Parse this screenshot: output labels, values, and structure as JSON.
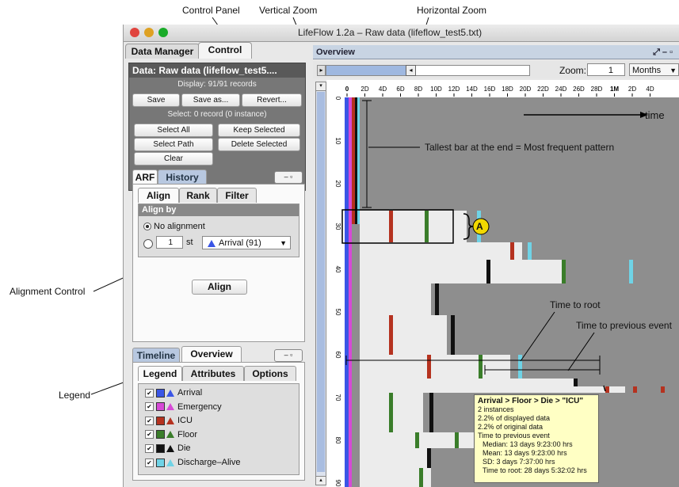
{
  "callouts": {
    "control_panel": "Control Panel",
    "vertical_zoom": "Vertical Zoom",
    "horizontal_zoom": "Horizontal Zoom",
    "alignment_control": "Alignment Control",
    "legend": "Legend",
    "time": "time",
    "tallest_bar": "Tallest bar at the end = Most frequent pattern",
    "marker_a": "A",
    "time_to_root": "Time to root",
    "time_to_previous": "Time to previous event"
  },
  "window": {
    "title": "LifeFlow 1.2a – Raw data (lifeflow_test5.txt)"
  },
  "left_tabs": [
    "Data Manager",
    "Control"
  ],
  "data_box": {
    "header": "Data: Raw data (lifeflow_test5....",
    "display": "Display: 91/91 records",
    "save": "Save",
    "save_as": "Save as...",
    "revert": "Revert...",
    "select": "Select: 0 record (0 instance)",
    "select_all": "Select All",
    "keep_selected": "Keep Selected",
    "select_path": "Select Path",
    "delete_selected": "Delete Selected",
    "clear": "Clear"
  },
  "arf_tabs": [
    "ARF",
    "History"
  ],
  "align_tabs": [
    "Align",
    "Rank",
    "Filter"
  ],
  "align_by": {
    "header": "Align by",
    "no_alignment": "No alignment",
    "stepper_value": "1",
    "ordinal_suffix": "st",
    "event_option": "Arrival (91)",
    "align_button": "Align"
  },
  "bottom_tabs": [
    "Timeline",
    "Overview"
  ],
  "legend_tabs": [
    "Legend",
    "Attributes",
    "Options"
  ],
  "legend_items": [
    {
      "label": "Arrival",
      "color": "#3a55e6"
    },
    {
      "label": "Emergency",
      "color": "#d64ad6"
    },
    {
      "label": "ICU",
      "color": "#b5321f"
    },
    {
      "label": "Floor",
      "color": "#3a7d2a"
    },
    {
      "label": "Die",
      "color": "#111111"
    },
    {
      "label": "Discharge–Alive",
      "color": "#6fd3e6"
    }
  ],
  "overview": {
    "title": "Overview",
    "zoom_label": "Zoom:",
    "zoom_value": "1",
    "zoom_unit": "Months",
    "x_ticks": [
      "0",
      "2D",
      "4D",
      "6D",
      "8D",
      "10D",
      "12D",
      "14D",
      "16D",
      "18D",
      "20D",
      "22D",
      "24D",
      "26D",
      "28D",
      "1M",
      "2D",
      "4D"
    ],
    "y_ticks": [
      "0",
      "10",
      "20",
      "30",
      "40",
      "50",
      "60",
      "70",
      "80",
      "90"
    ]
  },
  "tooltip": {
    "title": "Arrival > Floor > Die > \"ICU\"",
    "lines": [
      "2 instances",
      "2.2% of displayed data",
      "2.2% of original data",
      "Time to previous event",
      "Median: 13 days 9:23:00 hrs",
      "Mean: 13 days 9:23:00 hrs",
      "SD: 3 days 7:37:00 hrs",
      "Time to root: 28 days 5:32:02 hrs"
    ]
  }
}
